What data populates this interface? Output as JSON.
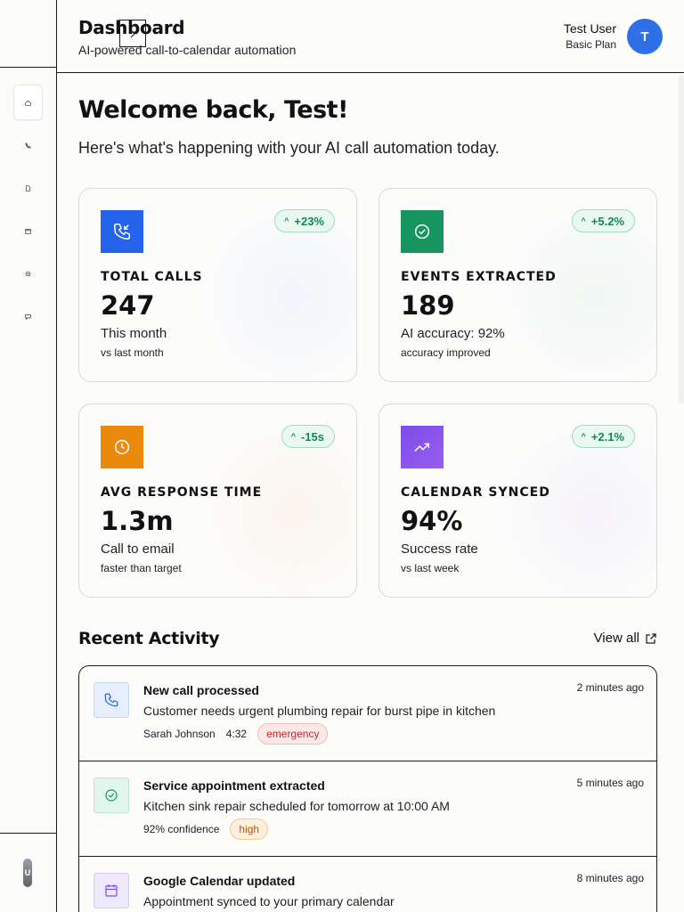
{
  "header": {
    "title": "Dashboard",
    "subtitle": "AI-powered call-to-calendar automation",
    "user_name": "Test User",
    "user_plan": "Basic Plan",
    "avatar_initial": "T"
  },
  "sidebar": {
    "items": [
      {
        "name": "home",
        "icon": "home-icon",
        "active": true
      },
      {
        "name": "calls",
        "icon": "phone-icon",
        "active": false
      },
      {
        "name": "documents",
        "icon": "document-icon",
        "active": false
      },
      {
        "name": "calendar",
        "icon": "calendar-icon",
        "active": false
      },
      {
        "name": "settings",
        "icon": "gear-icon",
        "active": false
      },
      {
        "name": "messages",
        "icon": "chat-icon",
        "active": false
      }
    ],
    "user_initial": "U"
  },
  "welcome": {
    "title": "Welcome back, Test!",
    "subtitle": "Here's what's happening with your AI call automation today."
  },
  "stats": [
    {
      "label": "TOTAL CALLS",
      "value": "247",
      "desc": "This month",
      "sub": "vs last month",
      "trend": "+23%",
      "icon": "phone-incoming-icon",
      "color": "#2563eb"
    },
    {
      "label": "EVENTS EXTRACTED",
      "value": "189",
      "desc": "AI accuracy: 92%",
      "sub": "accuracy improved",
      "trend": "+5.2%",
      "icon": "check-circle-icon",
      "color": "#16955f"
    },
    {
      "label": "AVG RESPONSE TIME",
      "value": "1.3m",
      "desc": "Call to email",
      "sub": "faster than target",
      "trend": "-15s",
      "icon": "clock-icon",
      "color": "#ea8a0c"
    },
    {
      "label": "CALENDAR SYNCED",
      "value": "94%",
      "desc": "Success rate",
      "sub": "vs last week",
      "trend": "+2.1%",
      "icon": "trending-up-icon",
      "color": "#7c4dea"
    }
  ],
  "activity": {
    "title": "Recent Activity",
    "view_all": "View all",
    "items": [
      {
        "title": "New call processed",
        "desc": "Customer needs urgent plumbing repair for burst pipe in kitchen",
        "time": "2 minutes ago",
        "meta1": "Sarah Johnson",
        "meta2": "4:32",
        "tag": "emergency",
        "icon": "phone-icon"
      },
      {
        "title": "Service appointment extracted",
        "desc": "Kitchen sink repair scheduled for tomorrow at 10:00 AM",
        "time": "5 minutes ago",
        "meta1": "92% confidence",
        "meta2": "",
        "tag": "high",
        "icon": "check-circle-icon"
      },
      {
        "title": "Google Calendar updated",
        "desc": "Appointment synced to your primary calendar",
        "time": "8 minutes ago",
        "meta1": "",
        "meta2": "",
        "tag": "",
        "icon": "calendar-icon"
      }
    ]
  }
}
